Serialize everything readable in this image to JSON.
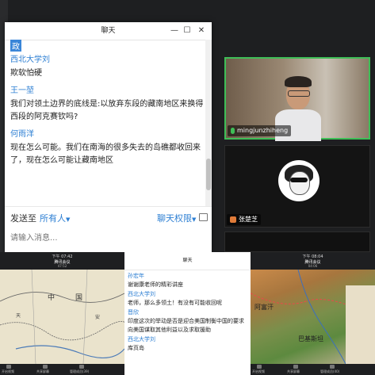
{
  "main_chat": {
    "title": "聊天",
    "win_min": "—",
    "win_max": "☐",
    "win_close": "✕",
    "partial_text": "政",
    "messages": [
      {
        "sender": "西北大学刘",
        "text": "欺软怕硬"
      },
      {
        "sender": "王一堃",
        "text": "我们对领土边界的底线是:以放弃东段的藏南地区来换得西段的阿克赛钦吗?"
      },
      {
        "sender": "何雨洋",
        "text": "现在怎么可能。我们在南海的很多失去的岛礁都收回来了，现在怎么可能让藏南地区"
      }
    ],
    "send_to_label": "发送至",
    "send_to_value": "所有人",
    "permission_label": "聊天权限",
    "input_placeholder": "请输入消息..."
  },
  "video_tiles": [
    {
      "name": "mingjunzhiheng"
    },
    {
      "name": "张楚芝"
    }
  ],
  "shared_left": {
    "time": "下午 07:42",
    "app": "腾讯会议",
    "sub": "47:52",
    "toolbar": [
      "开启视频",
      "共享屏幕",
      "管理成员(39)"
    ],
    "map_labels": [
      "中",
      "国",
      "天",
      "安"
    ]
  },
  "shared_right": {
    "time": "下午 08:04",
    "app": "腾讯会议",
    "sub": "04:06",
    "toolbar": [
      "开启视频",
      "共享屏幕",
      "管理成员(40)"
    ],
    "map_labels": [
      "阿富汗",
      "巴基斯坦"
    ]
  },
  "mini_chat": {
    "title": "聊天",
    "messages": [
      {
        "sender": "孙宏年",
        "text": "谢谢康老师的精彩讲座"
      },
      {
        "sender": "西北大学刘",
        "text": "老师，那么多领土！有没有可能收回呢"
      },
      {
        "sender": "晋欣",
        "text": "印度这次的举动是否是迎合美国制衡中国的要求向美国谋取其他利益以及求取援助"
      },
      {
        "sender": "西北大学刘",
        "text": "库页岛"
      }
    ]
  }
}
